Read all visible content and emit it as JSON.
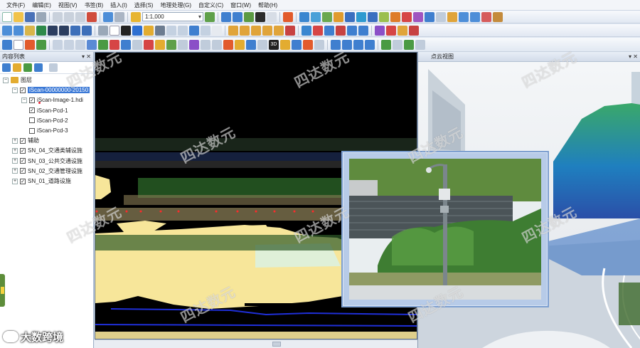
{
  "menu": {
    "items": [
      "文件(F)",
      "编辑(E)",
      "视图(V)",
      "书签(B)",
      "插入(I)",
      "选择(S)",
      "地理处理(G)",
      "自定义(C)",
      "窗口(W)",
      "帮助(H)"
    ]
  },
  "toolbar": {
    "scale_value": "1:1,000",
    "btn_3d_label": "3D"
  },
  "toc": {
    "title": "内容列表",
    "pin_label": "▾ ✕",
    "layers": [
      {
        "label": "图层",
        "level": 0,
        "expander": "−",
        "checked": null
      },
      {
        "label": "iScan-00000000-20150",
        "level": 1,
        "expander": "−",
        "checked": true,
        "selected": true
      },
      {
        "label": "iScan-Image-1.hdi",
        "level": 2,
        "expander": "−",
        "checked": true
      },
      {
        "label": "iScan-Pcd-1",
        "level": 2,
        "expander": "",
        "checked": true
      },
      {
        "label": "iScan-Pcd-2",
        "level": 2,
        "expander": "",
        "checked": false
      },
      {
        "label": "iScan-Pcd-3",
        "level": 2,
        "expander": "",
        "checked": false
      },
      {
        "label": "辅助",
        "level": 1,
        "expander": "+",
        "checked": true
      },
      {
        "label": "SN_04_交通类辅设施",
        "level": 1,
        "expander": "+",
        "checked": true
      },
      {
        "label": "SN_03_公共交通设施",
        "level": 1,
        "expander": "+",
        "checked": true
      },
      {
        "label": "SN_02_交通管理设施",
        "level": 1,
        "expander": "+",
        "checked": true
      },
      {
        "label": "SN_01_道路设施",
        "level": 1,
        "expander": "+",
        "checked": true
      }
    ]
  },
  "cloud_view": {
    "title": "点云视图",
    "pin_label": "▾ ✕"
  },
  "watermark": "四达数元",
  "brand": "大数跨境",
  "colors": {
    "accent": "#3c79d6",
    "map_fill": "#f7e69a",
    "map_background": "#000000",
    "photo_frame": "#b7cbe8"
  }
}
